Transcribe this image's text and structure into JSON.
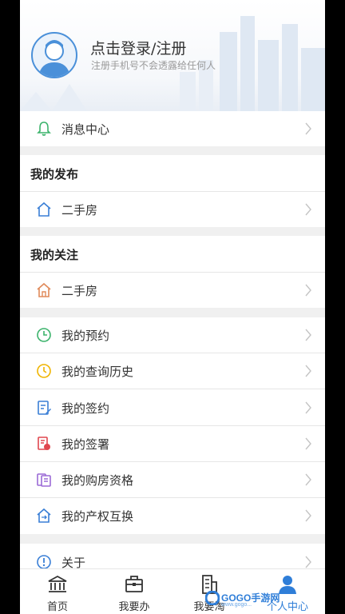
{
  "header": {
    "login_title": "点击登录/注册",
    "login_subtitle": "注册手机号不会透露给任何人"
  },
  "menu": {
    "message_center": "消息中心",
    "my_publish_title": "我的发布",
    "publish_second_hand": "二手房",
    "my_follow_title": "我的关注",
    "follow_second_hand": "二手房",
    "items": [
      {
        "label": "我的预约",
        "icon": "clock-icon",
        "color": "#3bb36b"
      },
      {
        "label": "我的查询历史",
        "icon": "history-icon",
        "color": "#f0b400"
      },
      {
        "label": "我的签约",
        "icon": "sign-edit-icon",
        "color": "#3a7fd6"
      },
      {
        "label": "我的签署",
        "icon": "document-seal-icon",
        "color": "#e0464e"
      },
      {
        "label": "我的购房资格",
        "icon": "qualification-icon",
        "color": "#9b6ad6"
      },
      {
        "label": "我的产权互换",
        "icon": "house-exchange-icon",
        "color": "#3a7fd6"
      }
    ],
    "about": "关于"
  },
  "tabbar": {
    "home": "首页",
    "handle": "我要办",
    "search": "我要淘",
    "profile": "个人中心",
    "active_color": "#2f7ed8"
  },
  "watermark": {
    "brand": "GOGO手游网",
    "url": "www.gogo..."
  }
}
